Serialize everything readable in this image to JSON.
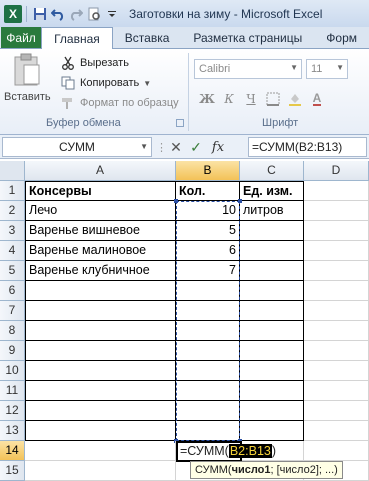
{
  "window": {
    "title": "Заготовки на зиму  -  Microsoft Excel",
    "app_icon": "excel-icon",
    "quick_access": [
      "save-icon",
      "undo-icon",
      "redo-icon",
      "print-preview-icon",
      "customize-icon"
    ]
  },
  "ribbon": {
    "tabs": [
      {
        "label": "Файл"
      },
      {
        "label": "Главная"
      },
      {
        "label": "Вставка"
      },
      {
        "label": "Разметка страницы"
      },
      {
        "label": "Форм"
      }
    ],
    "active_tab": "Главная",
    "clipboard": {
      "paste_label": "Вставить",
      "cut_label": "Вырезать",
      "copy_label": "Копировать",
      "format_painter_label": "Формат по образцу",
      "group_label": "Буфер обмена"
    },
    "font": {
      "font_name": "Calibri",
      "font_size": "11",
      "bold": "Ж",
      "italic": "К",
      "underline": "Ч",
      "group_label": "Шрифт"
    }
  },
  "formula_bar": {
    "name_box": "СУММ",
    "cancel": "✕",
    "enter": "✓",
    "fx": "fx",
    "formula": "=СУММ(B2:B13)"
  },
  "sheet": {
    "columns": [
      "A",
      "B",
      "C",
      "D"
    ],
    "rows": [
      "1",
      "2",
      "3",
      "4",
      "5",
      "6",
      "7",
      "8",
      "9",
      "10",
      "11",
      "12",
      "13",
      "14",
      "15"
    ],
    "headers": {
      "a1": "Консервы",
      "b1": "Кол.",
      "c1": "Ед. изм."
    },
    "data": [
      {
        "name": "Лечо",
        "qty": "10",
        "unit": "литров"
      },
      {
        "name": "Варенье вишневое",
        "qty": "5",
        "unit": ""
      },
      {
        "name": "Варенье малиновое",
        "qty": "6",
        "unit": ""
      },
      {
        "name": "Варенье клубничное",
        "qty": "7",
        "unit": ""
      }
    ],
    "edit_cell": {
      "prefix": "=СУММ(",
      "ref": "B2:B13",
      "suffix": ")"
    }
  },
  "tooltip": {
    "func": "СУММ(",
    "arg1": "число1",
    "rest": "; [число2]; ...)"
  },
  "colors": {
    "file_tab": "#2a7a3d",
    "selection": "#2b4fa3",
    "ref_highlight": "#f5d33a",
    "header_selected": "#f3c258"
  }
}
